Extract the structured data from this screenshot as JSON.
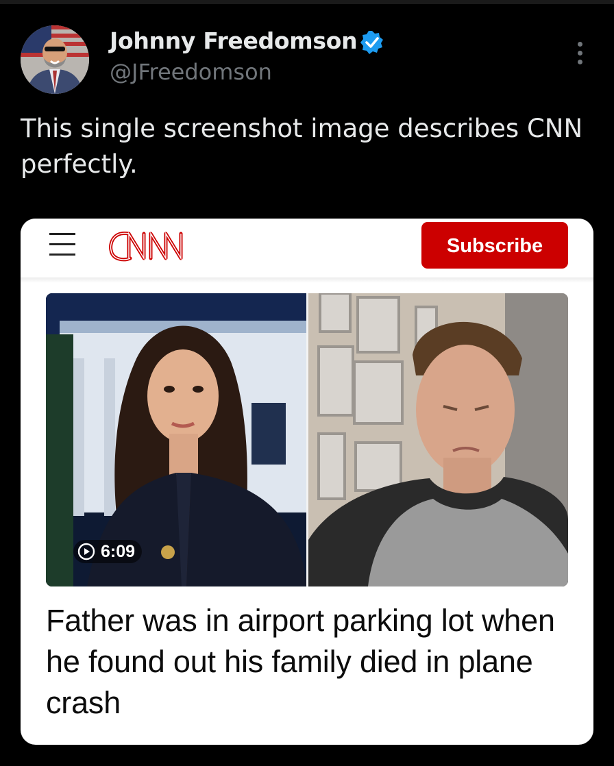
{
  "author": {
    "name": "Johnny Freedomson",
    "handle": "@JFreedomson",
    "verified": true,
    "verified_color": "#1d9bf0"
  },
  "more_icon": "more-vertical-icon",
  "tweet": {
    "text": "This single screenshot image describes CNN perfectly."
  },
  "embedded_card": {
    "menu_icon": "hamburger-menu-icon",
    "brand": "CNN",
    "brand_color": "#cc0000",
    "subscribe_label": "Subscribe",
    "video": {
      "duration": "6:09",
      "play_icon": "play-circle-icon"
    },
    "headline": "Father was in airport parking lot when he found out his family died in plane crash"
  },
  "colors": {
    "background": "#000000",
    "primary_text": "#e7e9ea",
    "secondary_text": "#71767b",
    "card_background": "#ffffff"
  }
}
